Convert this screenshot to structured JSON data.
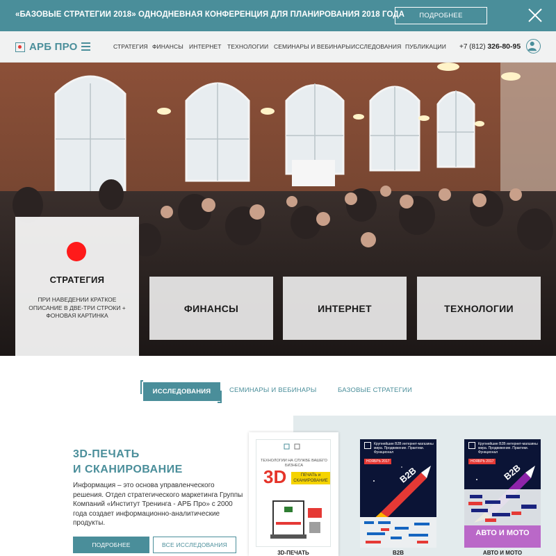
{
  "banner": {
    "text": "«БАЗОВЫЕ СТРАТЕГИИ 2018» ОДНОДНЕВНАЯ КОНФЕРЕНЦИЯ ДЛЯ ПЛАНИРОВАНИЯ 2018 ГОДА",
    "button_label": "ПОДРОБНЕЕ",
    "close_icon": "close-icon"
  },
  "nav": {
    "logo": "АРБ ПРО",
    "menu_icon": "hamburger-icon",
    "items": [
      "СТРАТЕГИЯ",
      "ФИНАНСЫ",
      "ИНТЕРНЕТ",
      "ТЕХНОЛОГИИ",
      "СЕМИНАРЫ И ВЕБИНАРЫ",
      "ИССЛЕДОВАНИЯ",
      "ПУБЛИКАЦИИ"
    ],
    "phone_prefix": "+7 (812)",
    "phone_number": "326-80-95",
    "user_icon": "user-avatar-icon"
  },
  "hero": {
    "featured": {
      "title": "СТРАТЕГИЯ",
      "description": "ПРИ НАВЕДЕНИИ КРАТКОЕ ОПИСАНИЕ В ДВЕ-ТРИ СТРОКИ + ФОНОВАЯ КАРТИНКА"
    },
    "cards": [
      "ФИНАНСЫ",
      "ИНТЕРНЕТ",
      "ТЕХНОЛОГИИ"
    ]
  },
  "tabs": {
    "active": "ИССЛЕДОВАНИЯ",
    "others": [
      "СЕМИНАРЫ И ВЕБИНАРЫ",
      "БАЗОВЫЕ СТРАТЕГИИ"
    ]
  },
  "section": {
    "title_line1": "3D-ПЕЧАТЬ",
    "title_line2": "И СКАНИРОВАНИЕ",
    "text": "Информация – это основа управленческого решения. Отдел стратегического маркетинга Группы Компаний «Институт Тренинга - АРБ Про» с 2000 года создает информационно-аналитические продукты.",
    "more_button": "ПОДРОБНЕЕ",
    "all_button": "ВСЕ ИССЛЕДОВАНИЯ"
  },
  "books": [
    {
      "caption": "3D-ПЕЧАТЬ",
      "cover_heading": "ТЕХНОЛОГИИ НА СЛУЖБЕ ВАШЕГО БИЗНЕСА",
      "cover_big": "3D",
      "cover_tag": "ПЕЧАТЬ и СКАНИРОВАНИЕ"
    },
    {
      "caption": "B2B",
      "cover_text": "Крупнейшие B2B интернет-магазины мира. Продвижение. Практики. Функционал",
      "cover_badge": "НОЯБРЬ 2017",
      "cover_big": "B2B"
    },
    {
      "caption": "АВТО И МОТО",
      "cover_text": "Крупнейшие B2B интернет-магазины мира. Продвижение. Практики. Функционал",
      "cover_badge": "НОЯБРЬ 2017",
      "cover_big": "B2B",
      "cover_bottom": "АВТО И МОТО"
    }
  ],
  "colors": {
    "accent": "#4a8e9a",
    "red_dot": "#ff1a1a",
    "panel": "#e3ebed"
  }
}
